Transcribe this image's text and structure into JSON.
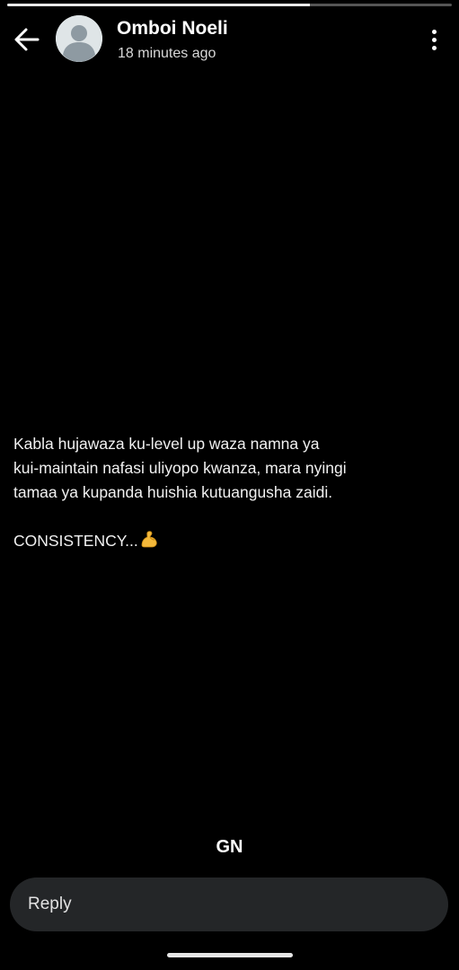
{
  "status": {
    "progress": 0.68,
    "contact_name": "Omboi Noeli",
    "timestamp": "18 minutes ago",
    "lines": [
      "Kabla hujawaza ku-level up waza namna ya",
      "kui-maintain nafasi uliyopo kwanza, mara nyingi",
      "tamaa ya kupanda huishia kutuangusha zaidi."
    ],
    "tagline": "CONSISTENCY...",
    "tagline_emoji": "flexed-biceps-icon",
    "caption": "GN"
  },
  "reply": {
    "placeholder": "Reply"
  },
  "icons": {
    "back": "back-arrow-icon",
    "menu": "more-vertical-icon",
    "avatar": "default-avatar-icon"
  },
  "colors": {
    "background": "#000000",
    "progress_fill": "#e9e9e9",
    "progress_track": "#555555",
    "reply_bar": "#242628"
  }
}
